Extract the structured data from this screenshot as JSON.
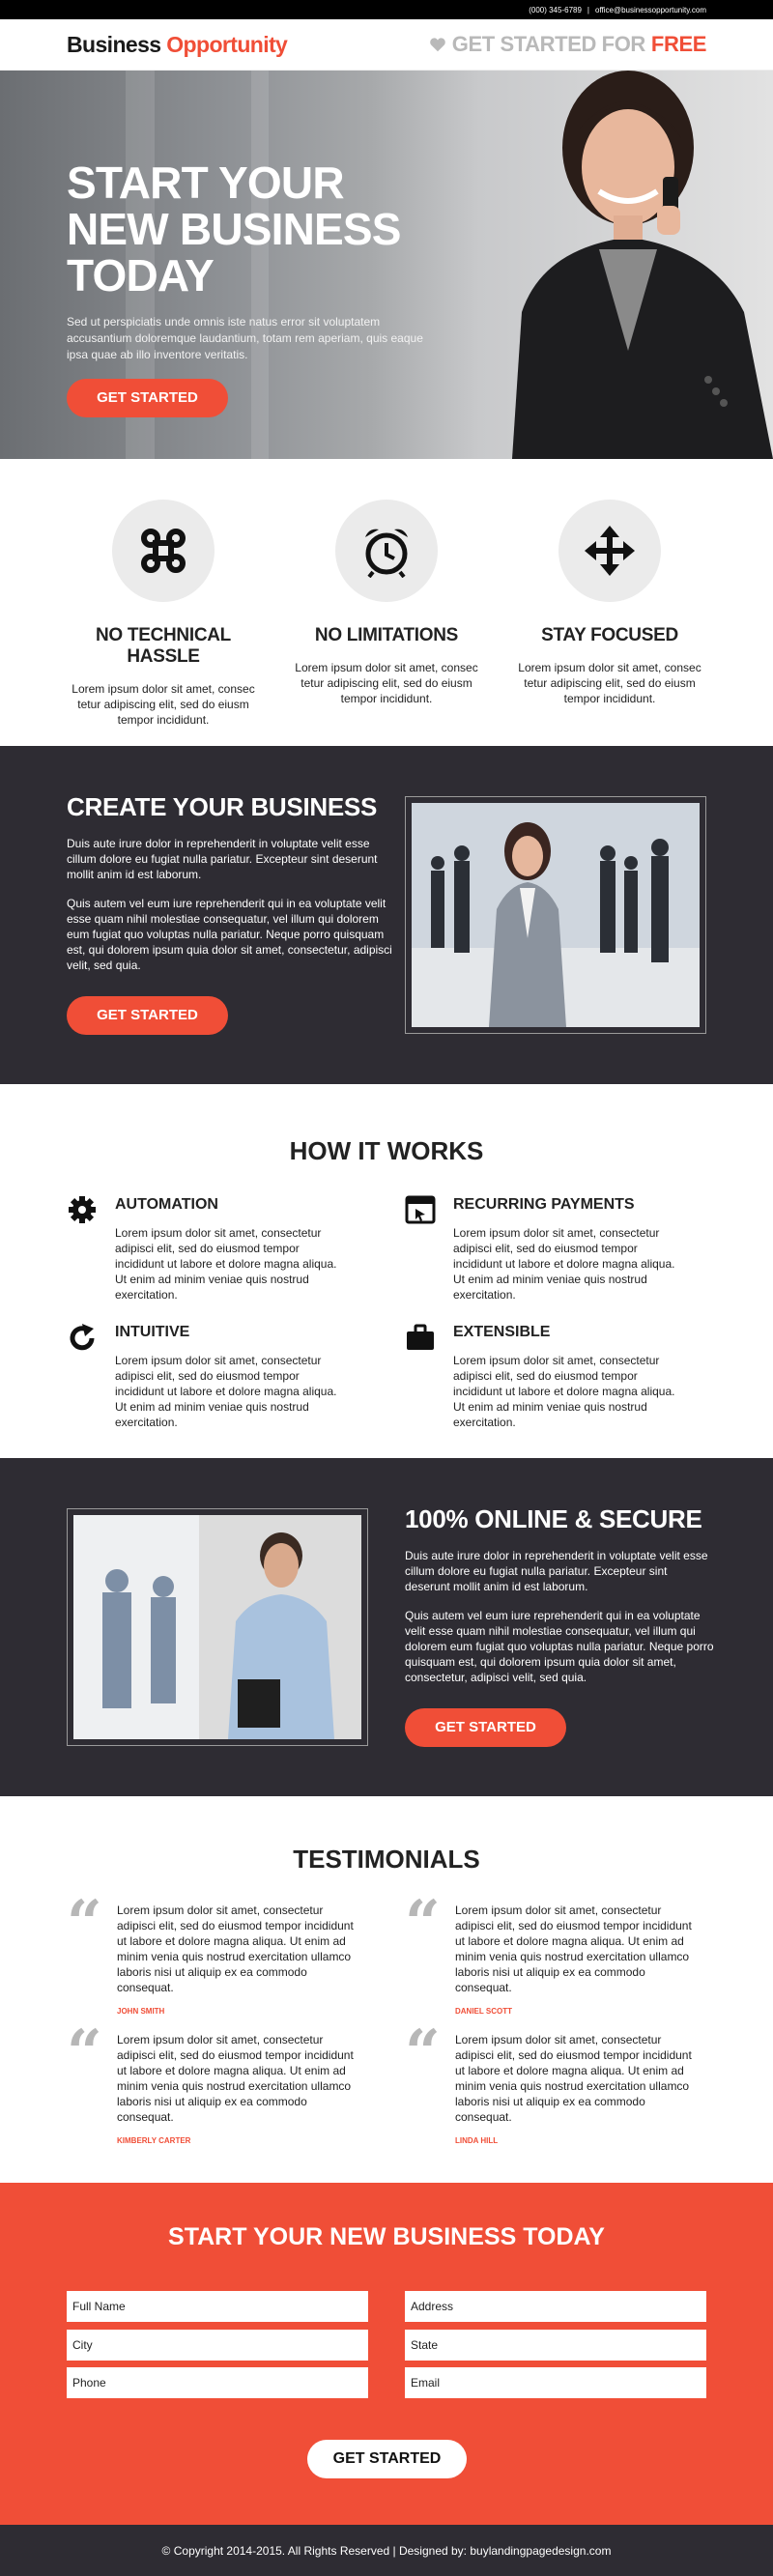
{
  "topbar": {
    "phone": "(000) 345-6789",
    "separator": "|",
    "email": "office@businessopportunity.com"
  },
  "header": {
    "logo_part1": "Business",
    "logo_part2": "Opportunity",
    "cta_prefix": "GET STARTED FOR",
    "cta_free": "FREE"
  },
  "hero": {
    "title": "START YOUR NEW BUSINESS TODAY",
    "subtitle": "Sed ut perspiciatis unde omnis iste natus error sit voluptatem accusantium doloremque laudantium, totam rem aperiam, quis eaque ipsa quae ab illo inventore veritatis.",
    "button": "GET STARTED"
  },
  "features": [
    {
      "icon": "command-icon",
      "title": "NO TECHNICAL HASSLE",
      "text": "Lorem ipsum dolor sit amet, consec tetur adipiscing elit, sed do eiusm tempor incididunt."
    },
    {
      "icon": "alarm-clock-icon",
      "title": "NO LIMITATIONS",
      "text": "Lorem ipsum dolor sit amet, consec tetur adipiscing elit, sed do eiusm tempor incididunt."
    },
    {
      "icon": "move-arrows-icon",
      "title": "STAY FOCUSED",
      "text": "Lorem ipsum dolor sit amet, consec tetur adipiscing elit, sed do eiusm tempor incididunt."
    }
  ],
  "create": {
    "title": "CREATE YOUR BUSINESS",
    "p1": "Duis aute irure dolor in reprehenderit in voluptate velit esse cillum dolore eu fugiat nulla pariatur. Excepteur sint deserunt mollit anim id est laborum.",
    "p2": "Quis autem vel eum iure reprehenderit qui in ea voluptate velit esse quam nihil molestiae consequatur, vel illum qui dolorem eum fugiat quo voluptas nulla pariatur. Neque porro quisquam est, qui dolorem ipsum quia dolor sit amet, consectetur, adipisci velit, sed quia.",
    "button": "GET STARTED"
  },
  "how": {
    "title": "HOW IT WORKS",
    "items": [
      {
        "icon": "gear-icon",
        "title": "AUTOMATION",
        "text": "Lorem ipsum dolor sit amet, consectetur adipisci elit, sed do eiusmod tempor incididunt ut labore et dolore magna aliqua. Ut enim ad minim veniae quis nostrud exercitation."
      },
      {
        "icon": "browser-window-icon",
        "title": "RECURRING PAYMENTS",
        "text": "Lorem ipsum dolor sit amet, consectetur adipisci elit, sed do eiusmod tempor incididunt ut labore et dolore magna aliqua. Ut enim ad minim veniae quis nostrud exercitation."
      },
      {
        "icon": "refresh-icon",
        "title": "INTUITIVE",
        "text": "Lorem ipsum dolor sit amet, consectetur adipisci elit, sed do eiusmod tempor incididunt ut labore et dolore magna aliqua. Ut enim ad minim veniae quis nostrud exercitation."
      },
      {
        "icon": "briefcase-icon",
        "title": "EXTENSIBLE",
        "text": "Lorem ipsum dolor sit amet, consectetur adipisci elit, sed do eiusmod tempor incididunt ut labore et dolore magna aliqua. Ut enim ad minim veniae quis nostrud exercitation."
      }
    ]
  },
  "secure": {
    "title": "100% ONLINE & SECURE",
    "p1": "Duis aute irure dolor in reprehenderit in voluptate velit esse cillum dolore eu fugiat nulla pariatur. Excepteur sint deserunt mollit anim id est laborum.",
    "p2": "Quis autem vel eum iure reprehenderit qui in ea voluptate velit esse quam nihil molestiae consequatur, vel illum qui dolorem eum fugiat quo voluptas nulla pariatur. Neque porro quisquam est, qui dolorem ipsum quia dolor sit amet, consectetur, adipisci velit, sed quia.",
    "button": "GET STARTED"
  },
  "testimonials": {
    "title": "TESTIMONIALS",
    "items": [
      {
        "text": "Lorem ipsum dolor sit amet, consectetur adipisci elit, sed do eiusmod tempor incididunt ut labore et dolore magna aliqua. Ut enim ad minim venia quis nostrud exercitation ullamco laboris nisi ut aliquip ex ea commodo consequat.",
        "name": "JOHN SMITH"
      },
      {
        "text": "Lorem ipsum dolor sit amet, consectetur adipisci elit, sed do eiusmod tempor incididunt ut labore et dolore magna aliqua. Ut enim ad minim venia quis nostrud exercitation ullamco laboris nisi ut aliquip ex ea commodo consequat.",
        "name": "DANIEL SCOTT"
      },
      {
        "text": "Lorem ipsum dolor sit amet, consectetur adipisci elit, sed do eiusmod tempor incididunt ut labore et dolore magna aliqua. Ut enim ad minim venia quis nostrud exercitation ullamco laboris nisi ut aliquip ex ea commodo consequat.",
        "name": "KIMBERLY CARTER"
      },
      {
        "text": "Lorem ipsum dolor sit amet, consectetur adipisci elit, sed do eiusmod tempor incididunt ut labore et dolore magna aliqua. Ut enim ad minim venia quis nostrud exercitation ullamco laboris nisi ut aliquip ex ea commodo consequat.",
        "name": "LINDA HILL"
      }
    ]
  },
  "form": {
    "title": "START YOUR NEW BUSINESS TODAY",
    "full_name": "Full Name",
    "address": "Address",
    "city": "City",
    "state": "State",
    "phone": "Phone",
    "email": "Email",
    "button": "GET STARTED"
  },
  "footer": {
    "text": "© Copyright 2014-2015. All Rights Reserved  |  Designed by: buylandingpagedesign.com"
  },
  "colors": {
    "accent": "#f04e37",
    "dark": "#2e2c33"
  }
}
